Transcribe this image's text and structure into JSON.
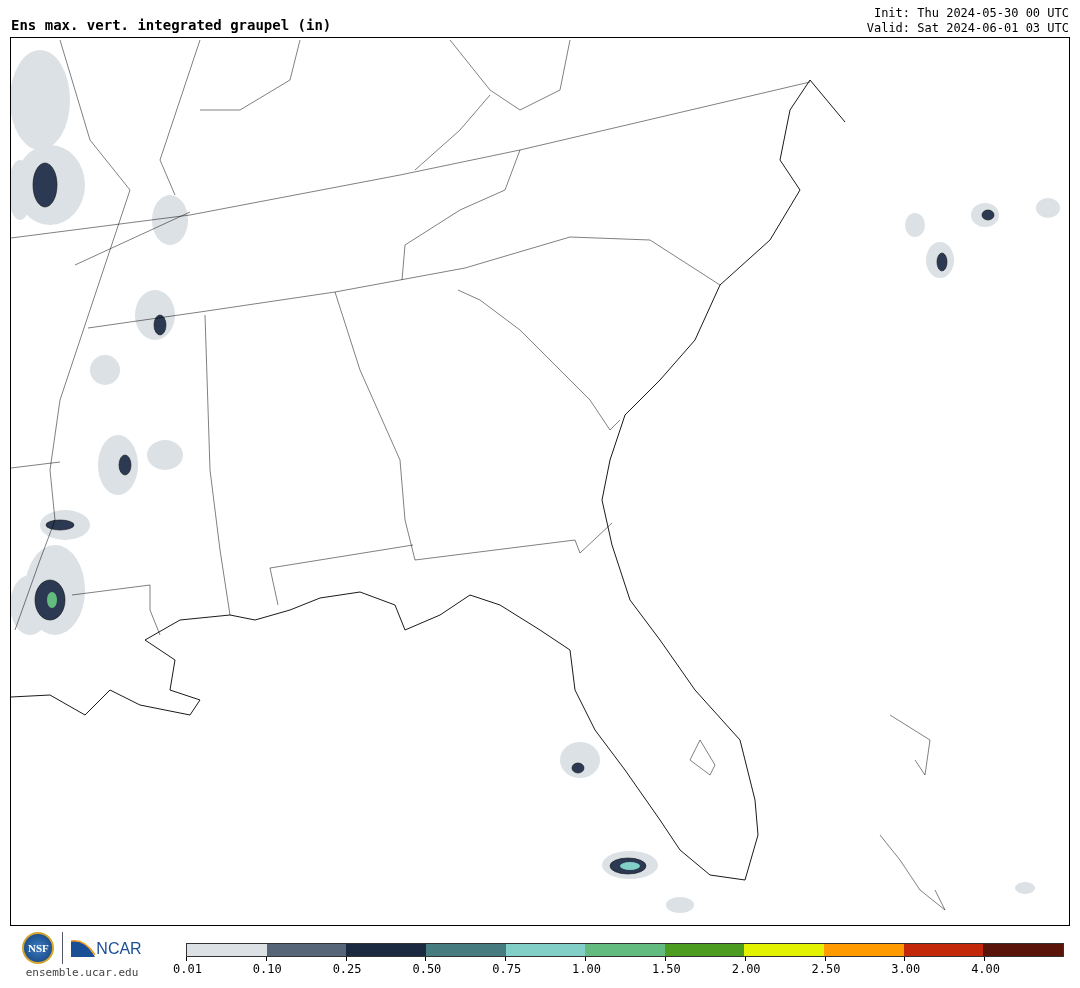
{
  "title": "Ens max. vert. integrated graupel (in)",
  "init": "Init: Thu 2024-05-30 00 UTC",
  "valid": "Valid: Sat 2024-06-01 03 UTC",
  "logos": {
    "nsf": "NSF",
    "ncar": "NCAR",
    "url": "ensemble.ucar.edu"
  },
  "legend": [
    {
      "label": "0.01",
      "color": "#dce1e5"
    },
    {
      "label": "0.10",
      "color": "#566577"
    },
    {
      "label": "0.25",
      "color": "#1b2a40"
    },
    {
      "label": "0.50",
      "color": "#467b80"
    },
    {
      "label": "0.75",
      "color": "#82cfc8"
    },
    {
      "label": "1.00",
      "color": "#63bb7f"
    },
    {
      "label": "1.50",
      "color": "#4c9c22"
    },
    {
      "label": "2.00",
      "color": "#e2f200"
    },
    {
      "label": "2.50",
      "color": "#ff9a00"
    },
    {
      "label": "3.00",
      "color": "#c4280a"
    },
    {
      "label": "4.00",
      "color": "#5a1409"
    }
  ]
}
